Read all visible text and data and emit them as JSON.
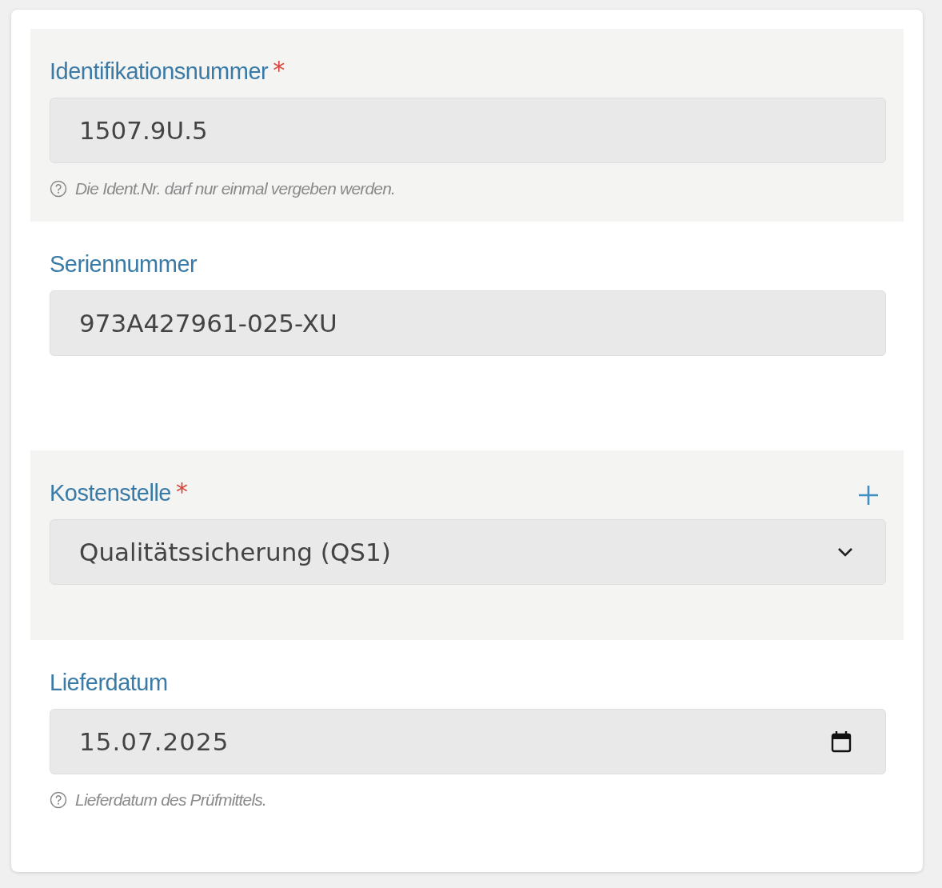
{
  "fields": [
    {
      "kind": "text",
      "label": "Identifikationsnummer",
      "required_mark": "*",
      "value": "1507.9U.5",
      "help": "Die Ident.Nr. darf nur einmal vergeben werden."
    },
    {
      "kind": "text",
      "label": "Seriennummer",
      "value": "973A427961-025-XU"
    },
    {
      "kind": "select",
      "label": "Kostenstelle",
      "required_mark": "*",
      "value": "Qualitätssicherung (QS1)",
      "add_button": true
    },
    {
      "kind": "date",
      "label": "Lieferdatum",
      "value": "15.07.2025",
      "help": "Lieferdatum des Prüfmittels."
    }
  ]
}
